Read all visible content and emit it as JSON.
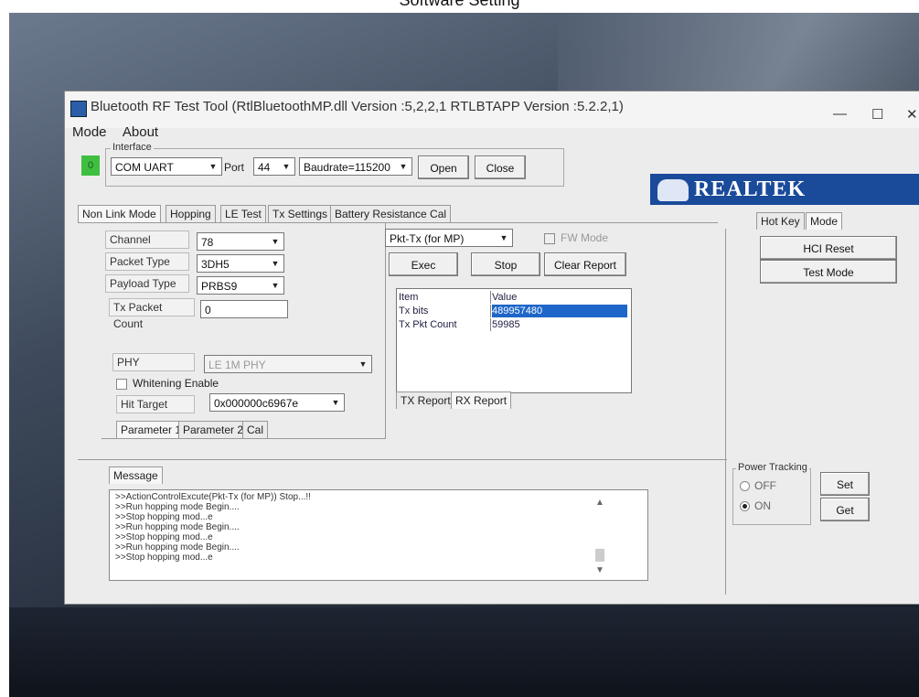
{
  "caption": "Software Setting",
  "window": {
    "title": "Bluetooth RF Test Tool (RtlBluetoothMP.dll Version :5,2,2,1   RTLBTAPP Version :5.2.2,1)",
    "minimize": "—",
    "maximize": "☐",
    "close": "✕",
    "menu": [
      "Mode",
      "About"
    ]
  },
  "interface": {
    "group_label": "Interface",
    "status": "0",
    "type": "COM UART",
    "port_label": "Port",
    "port": "44",
    "baudrate": "Baudrate=115200",
    "open": "Open",
    "close": "Close"
  },
  "brand": {
    "name": "REALTEK"
  },
  "main_tabs": [
    "Non Link Mode",
    "Hopping",
    "LE Test",
    "Tx Settings",
    "Battery Resistance Cal"
  ],
  "settings": {
    "channel_label": "Channel",
    "channel": "78",
    "packet_type_label": "Packet Type",
    "packet_type": "3DH5",
    "payload_type_label": "Payload Type",
    "payload_type": "PRBS9",
    "tx_count_label": "Tx Packet Count",
    "tx_count": "0",
    "phy_label": "PHY",
    "phy": "LE 1M PHY",
    "whitening_label": "Whitening Enable",
    "hit_target_label": "Hit Target",
    "hit_target": "0x000000c6967e"
  },
  "param_tabs": [
    "Parameter 1",
    "Parameter 2",
    "Cal"
  ],
  "test": {
    "mode": "Pkt-Tx (for MP)",
    "fw_mode": "FW Mode",
    "exec": "Exec",
    "stop": "Stop",
    "clear_report": "Clear Report"
  },
  "report": {
    "headers": [
      "Item",
      "Value"
    ],
    "rows": [
      {
        "item": "Tx bits",
        "value": "489957480"
      },
      {
        "item": "Tx Pkt Count",
        "value": "59985"
      }
    ],
    "tabs": [
      "TX Report",
      "RX Report"
    ]
  },
  "right_panel": {
    "tabs": [
      "Hot Key",
      "Mode"
    ],
    "hci_reset": "HCI Reset",
    "test_mode": "Test Mode",
    "power_tracking": "Power Tracking",
    "off": "OFF",
    "on": "ON",
    "set": "Set",
    "get": "Get"
  },
  "message": {
    "tab": "Message",
    "lines": [
      ">>ActionControlExcute(Pkt-Tx (for MP)) Stop...!!",
      ">>Run hopping mode Begin....",
      ">>Stop hopping mod...e",
      ">>Run hopping mode Begin....",
      ">>Stop hopping mod...e",
      ">>Run hopping mode Begin....",
      ">>Stop hopping mod...e"
    ]
  }
}
